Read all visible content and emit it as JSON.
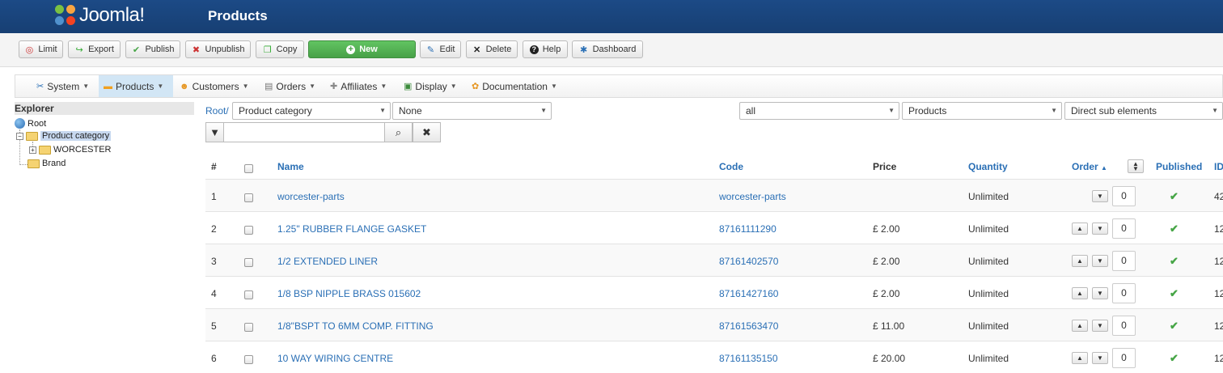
{
  "header": {
    "logo_text": "Joomla!",
    "title": "Products"
  },
  "toolbar": [
    {
      "label": "Limit",
      "icon": "limit-icon",
      "glyph": "◎"
    },
    {
      "label": "Export",
      "icon": "export-icon",
      "glyph": "↪"
    },
    {
      "label": "Publish",
      "icon": "check-icon",
      "glyph": "✔"
    },
    {
      "label": "Unpublish",
      "icon": "unpublish-icon",
      "glyph": "✖"
    },
    {
      "label": "Copy",
      "icon": "copy-icon",
      "glyph": "❐"
    },
    {
      "label": "New",
      "icon": "plus-icon",
      "glyph": "+"
    },
    {
      "label": "Edit",
      "icon": "edit-icon",
      "glyph": "✎"
    },
    {
      "label": "Delete",
      "icon": "delete-icon",
      "glyph": "✕"
    },
    {
      "label": "Help",
      "icon": "help-icon",
      "glyph": "?"
    },
    {
      "label": "Dashboard",
      "icon": "dashboard-icon",
      "glyph": "✱"
    }
  ],
  "menu": [
    {
      "label": "System",
      "icon": "system-icon",
      "glyph": "✂"
    },
    {
      "label": "Products",
      "icon": "products-icon",
      "glyph": "▬"
    },
    {
      "label": "Customers",
      "icon": "customers-icon",
      "glyph": "☻"
    },
    {
      "label": "Orders",
      "icon": "orders-icon",
      "glyph": "▤"
    },
    {
      "label": "Affiliates",
      "icon": "affiliates-icon",
      "glyph": "✚"
    },
    {
      "label": "Display",
      "icon": "display-icon",
      "glyph": "▣"
    },
    {
      "label": "Documentation",
      "icon": "documentation-icon",
      "glyph": "✿"
    }
  ],
  "explorer": {
    "title": "Explorer",
    "root": "Root",
    "category": "Product category",
    "worcester": "WORCESTER",
    "brand": "Brand"
  },
  "filters": {
    "root_link": "Root/",
    "category_select": "Product category",
    "none_select": "None",
    "all_select": "all",
    "products_select": "Products",
    "sub_select": "Direct sub elements"
  },
  "table": {
    "headers": {
      "num": "#",
      "name": "Name",
      "code": "Code",
      "price": "Price",
      "quantity": "Quantity",
      "order": "Order",
      "order_arrow": "▲",
      "published": "Published",
      "id": "ID"
    },
    "rows": [
      {
        "num": "1",
        "name": "worcester-parts",
        "code": "worcester-parts",
        "price": "",
        "quantity": "Unlimited",
        "order": "0",
        "id": "42"
      },
      {
        "num": "2",
        "name": "1.25\" RUBBER FLANGE GASKET",
        "code": "87161111290",
        "price": "£ 2.00",
        "quantity": "Unlimited",
        "order": "0",
        "id": "12"
      },
      {
        "num": "3",
        "name": "1/2 EXTENDED LINER",
        "code": "87161402570",
        "price": "£ 2.00",
        "quantity": "Unlimited",
        "order": "0",
        "id": "12"
      },
      {
        "num": "4",
        "name": "1/8 BSP NIPPLE BRASS 015602",
        "code": "87161427160",
        "price": "£ 2.00",
        "quantity": "Unlimited",
        "order": "0",
        "id": "12"
      },
      {
        "num": "5",
        "name": "1/8\"BSPT TO 6MM COMP. FITTING",
        "code": "87161563470",
        "price": "£ 11.00",
        "quantity": "Unlimited",
        "order": "0",
        "id": "12"
      },
      {
        "num": "6",
        "name": "10 WAY WIRING CENTRE",
        "code": "87161135150",
        "price": "£ 20.00",
        "quantity": "Unlimited",
        "order": "0",
        "id": "12"
      }
    ]
  },
  "colors": {
    "header": "#1c4a86",
    "link": "#2a6fb5",
    "new_button": "#51a351",
    "published": "#46a546",
    "active_menu": "#d2e6f5"
  }
}
